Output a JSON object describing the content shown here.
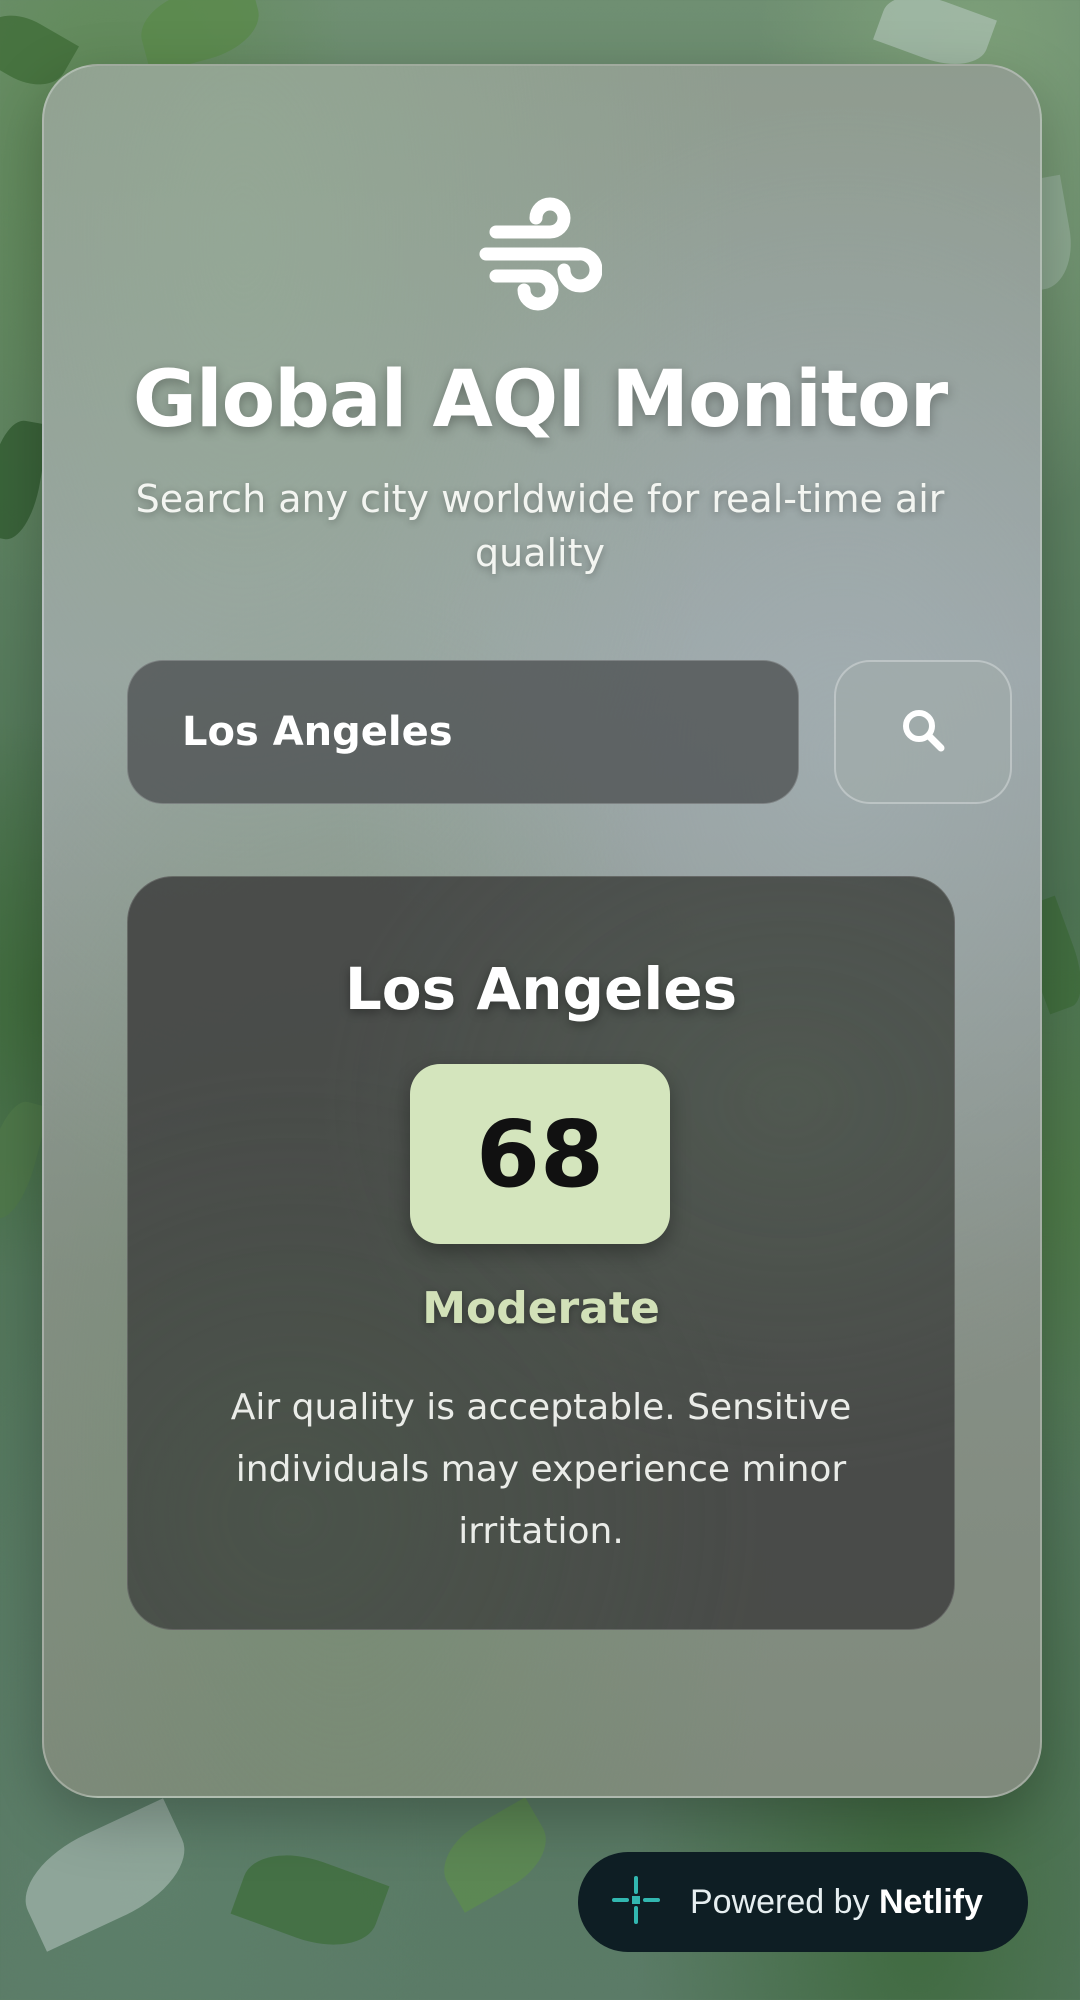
{
  "app": {
    "title": "Global AQI Monitor",
    "subtitle": "Search any city worldwide for real-time air quality",
    "logo_icon": "wind-icon"
  },
  "search": {
    "value": "Los Angeles",
    "button_icon": "search-icon"
  },
  "result": {
    "city": "Los Angeles",
    "aqi": "68",
    "level": "Moderate",
    "description": "Air quality is acceptable. Sensitive individuals may experience minor irritation.",
    "badge_color": "#d4e5bd",
    "level_color": "#d2e1b8"
  },
  "footer": {
    "powered_prefix": "Powered by",
    "powered_brand": "Netlify",
    "brand_icon": "netlify-icon"
  }
}
